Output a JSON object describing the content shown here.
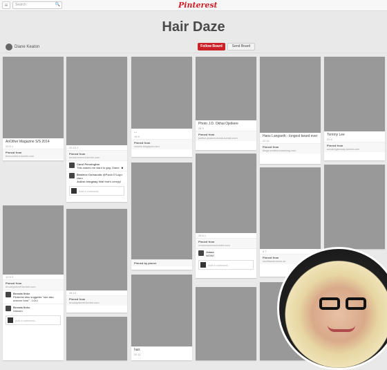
{
  "header": {
    "menu_glyph": "≡",
    "search_placeholder": "Search",
    "logo": "Pinterest"
  },
  "board": {
    "title": "Hair Daze",
    "owner": "Diane Keaton",
    "follow_label": "Follow Board",
    "send_label": "Send Board"
  },
  "pins": {
    "p1": {
      "desc": "AnOther Magazine S/S 2014",
      "stats": "20  6  1",
      "source_label": "Pinned from",
      "source": "thecoveteur.tumblr.com"
    },
    "p2": {
      "stats": "20  10  2",
      "source_label": "Pinned from",
      "source": "beardrevered.tumblr.com",
      "c1_name": "Carol Pennington",
      "c1_text": "This makes me want to gag, Diane. ☻",
      "c2_name": "Beatrice Cersocolo",
      "c2_text": "@Paolo D'Lugo: claro",
      "c3_name": "JoAnn Ivingway",
      "c3_text": "Wait that's creepy!",
      "add_comment": "Add a comment..."
    },
    "p3": {
      "desc": "...",
      "stats": "18  9",
      "source_label": "Pinned from",
      "source": "chaets.blogspot.com"
    },
    "p4": {
      "desc": "Photo J.D. Okhai Ojeikere",
      "stats": "24  9",
      "source_label": "Pinned from",
      "source": "justice-jeanne-maria.tumblr.com"
    },
    "p5": {
      "desc": "Hans Langseth - longest beard ever",
      "stats": "20  11",
      "source_label": "Pinned from",
      "source": "blogs.smithsonianmag.com"
    },
    "p6": {
      "desc": "Tommy Lee",
      "stats": "20  6",
      "source_label": "Pinned from",
      "source": "smokingbeauty.tumblr.com"
    },
    "p7": {
      "stats": "12  5  2",
      "source_label": "Pinned from",
      "source": "brooklynbeef.tumblr.com",
      "c1_name": "Brenda Ihrke",
      "c1_text": "Pinterest also suggests \"see also unicorn horn\" - LOL!",
      "c2_name": "Brenda Ihrke",
      "c2_text": "Unicorn",
      "add_comment": "Add a comment..."
    },
    "p8": {
      "stats": "28  14",
      "source_label": "Pinned from",
      "source": "brooklynbeef.tumblr.com"
    },
    "p9": {
      "source_label": "Pinned by pinner"
    },
    "p10": {
      "stats": "26  8  1",
      "source_label": "Pinned from",
      "source": "crowcrowcrow.tumblr.com",
      "c1_name": "Joana",
      "c1_text": "WOW!",
      "add_comment": "Add a comment..."
    },
    "p11": {
      "stats": "5  7",
      "source_label": "Pinned from",
      "source": "ceciliasvensson.se"
    },
    "p12": {
      "desc": "hair.",
      "stats": "20  11"
    }
  }
}
